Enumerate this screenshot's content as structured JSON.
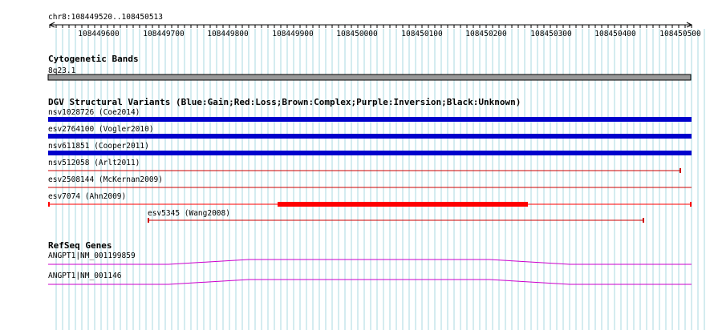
{
  "ruler": {
    "position": "chr8:108449520..108450513",
    "ticks": [
      "108449600",
      "108449700",
      "108449800",
      "108449900",
      "108450000",
      "108450100",
      "108450200",
      "108450300",
      "108450400",
      "108450500"
    ]
  },
  "cytoband": {
    "title": "Cytogenetic Bands",
    "band": "8q23.1"
  },
  "dgv": {
    "title": "DGV Structural Variants (Blue:Gain;Red:Loss;Brown:Complex;Purple:Inversion;Black:Unknown)",
    "variants": [
      {
        "label": "nsv1028726 (Coe2014)",
        "color": "#0000cc",
        "type": "gain"
      },
      {
        "label": "esv2764100 (Vogler2010)",
        "color": "#0000cc",
        "type": "gain"
      },
      {
        "label": "nsv611851 (Cooper2011)",
        "color": "#0000cc",
        "type": "gain"
      },
      {
        "label": "nsv512058 (Arlt2011)",
        "color": "#cc0000",
        "type": "loss"
      },
      {
        "label": "esv2508144 (McKernan2009)",
        "color": "#cc0000",
        "type": "loss"
      },
      {
        "label": "esv7074 (Ahn2009)",
        "color": "#ff0000",
        "type": "loss"
      },
      {
        "label": "esv5345 (Wang2008)",
        "color": "#cc0000",
        "type": "loss"
      }
    ]
  },
  "refseq": {
    "title": "RefSeq Genes",
    "genes": [
      {
        "label": "ANGPT1|NM_001199859",
        "color": "#cc00cc"
      },
      {
        "label": "ANGPT1|NM_001146",
        "color": "#cc00cc"
      }
    ]
  }
}
